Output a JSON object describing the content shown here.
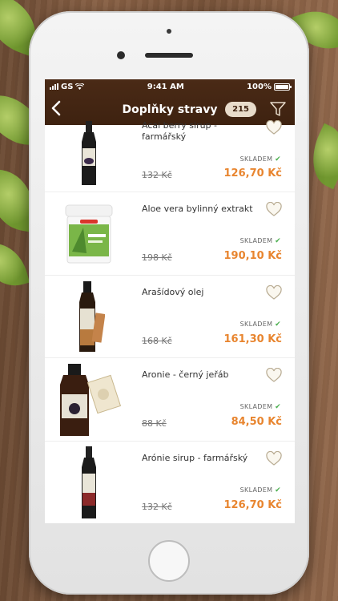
{
  "status_bar": {
    "carrier": "GS",
    "time": "9:41 AM",
    "battery": "100%",
    "battery_level": 1.0
  },
  "nav": {
    "title": "Doplňky stravy",
    "count": "215",
    "back_icon": "chevron-left-icon",
    "filter_icon": "funnel-icon"
  },
  "products": [
    {
      "name": "Acai berry sirup - farmářský",
      "stock": "SKLADEM",
      "old_price": "132 Kč",
      "price": "126,70 Kč"
    },
    {
      "name": "Aloe vera bylinný extrakt",
      "stock": "SKLADEM",
      "old_price": "198 Kč",
      "price": "190,10 Kč"
    },
    {
      "name": "Arašídový olej",
      "stock": "SKLADEM",
      "old_price": "168 Kč",
      "price": "161,30 Kč"
    },
    {
      "name": "Aronie - černý jeřáb",
      "stock": "SKLADEM",
      "old_price": "88 Kč",
      "price": "84,50 Kč"
    },
    {
      "name": "Arónie sirup - farmářský",
      "stock": "SKLADEM",
      "old_price": "132 Kč",
      "price": "126,70 Kč"
    }
  ],
  "colors": {
    "header_bg": "#3e2210",
    "price": "#e8852f",
    "badge_bg": "#e8dccb",
    "in_stock": "#4caf50"
  }
}
